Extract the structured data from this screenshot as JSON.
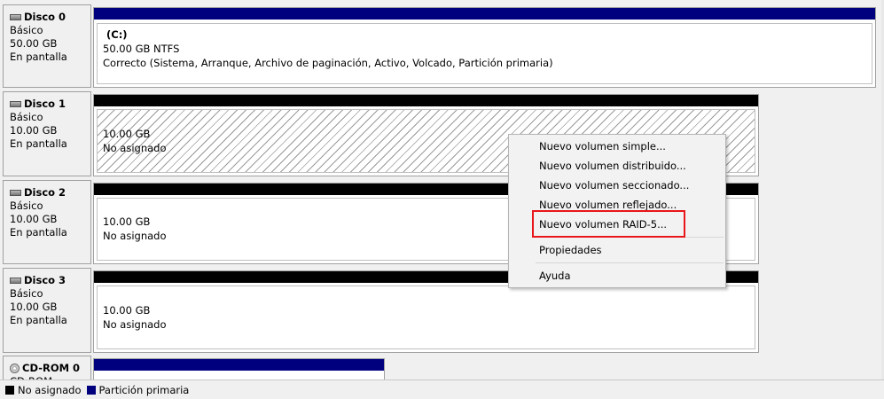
{
  "disks": [
    {
      "name": "Disco 0",
      "type": "Básico",
      "size": "50.00 GB",
      "status": "En pantalla",
      "partition": {
        "label": "(C:)",
        "size_fs": "50.00 GB NTFS",
        "health": "Correcto (Sistema, Arranque, Archivo de paginación, Activo, Volcado, Partición primaria)"
      }
    },
    {
      "name": "Disco 1",
      "type": "Básico",
      "size": "10.00 GB",
      "status": "En pantalla",
      "partition": {
        "size": "10.00 GB",
        "state": "No asignado"
      }
    },
    {
      "name": "Disco 2",
      "type": "Básico",
      "size": "10.00 GB",
      "status": "En pantalla",
      "partition": {
        "size": "10.00 GB",
        "state": "No asignado"
      }
    },
    {
      "name": "Disco 3",
      "type": "Básico",
      "size": "10.00 GB",
      "status": "En pantalla",
      "partition": {
        "size": "10.00 GB",
        "state": "No asignado"
      }
    },
    {
      "name": "CD-ROM 0",
      "type": "CD-ROM"
    }
  ],
  "context_menu": {
    "items": [
      "Nuevo volumen simple...",
      "Nuevo volumen distribuido...",
      "Nuevo volumen seccionado...",
      "Nuevo volumen reflejado...",
      "Nuevo volumen RAID-5...",
      "Propiedades",
      "Ayuda"
    ],
    "highlighted_item": "Nuevo volumen RAID-5..."
  },
  "legend": {
    "unallocated": "No asignado",
    "primary": "Partición primaria"
  },
  "colors": {
    "primary_bar": "#00007f",
    "unallocated_bar": "#000000",
    "highlight_box": "#e8161b"
  }
}
